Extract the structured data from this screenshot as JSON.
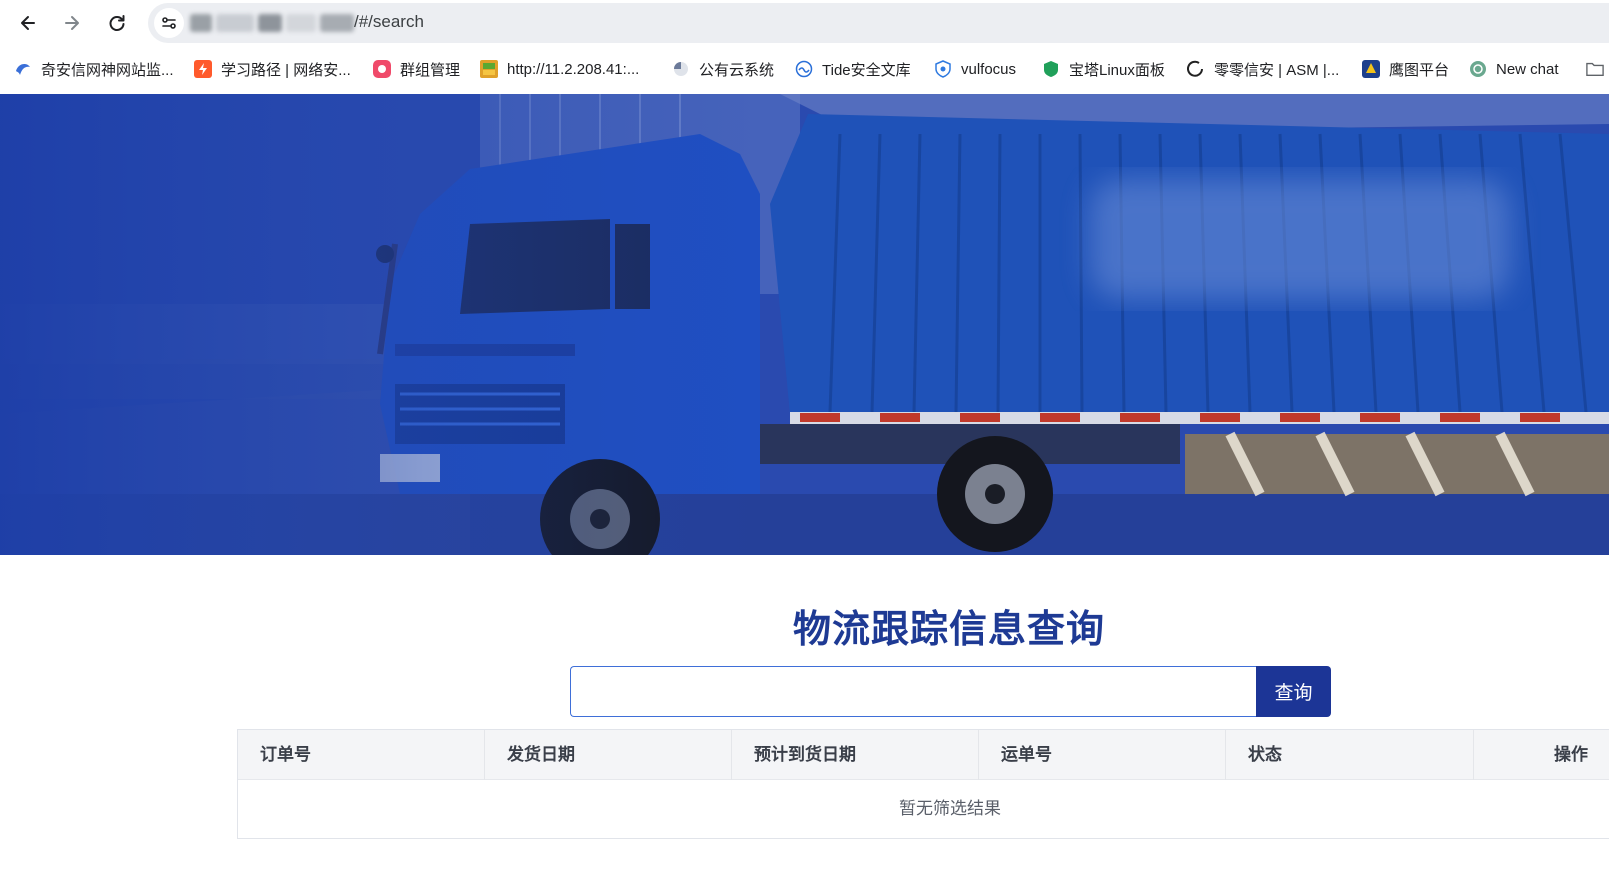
{
  "browser": {
    "url_visible": "/#/search",
    "nav": {
      "back_icon": "arrow-left-icon",
      "forward_icon": "arrow-right-icon",
      "reload_icon": "reload-icon"
    },
    "bookmarks": [
      {
        "label": "奇安信网神网站监...",
        "icon": "qianxin-icon",
        "color": "#3a6fd8"
      },
      {
        "label": "学习路径 | 网络安...",
        "icon": "bolt-icon",
        "color": "#ff5a2c"
      },
      {
        "label": "群组管理",
        "icon": "group-icon",
        "color": "#f04a6a"
      },
      {
        "label": "http://11.2.208.41:...",
        "icon": "cube-icon",
        "color": "#e0a12a"
      },
      {
        "label": "公有云系统",
        "icon": "cloud-icon",
        "color": "#6b7a99"
      },
      {
        "label": "Tide安全文库",
        "icon": "tide-icon",
        "color": "#2a6fd8"
      },
      {
        "label": "vulfocus",
        "icon": "shield-icon",
        "color": "#2f7ae0"
      },
      {
        "label": "宝塔Linux面板",
        "icon": "baota-icon",
        "color": "#20a05a"
      },
      {
        "label": "零零信安 | ASM |...",
        "icon": "ring-icon",
        "color": "#222222"
      },
      {
        "label": "鹰图平台",
        "icon": "eagle-icon",
        "color": "#f2c21a"
      },
      {
        "label": "New chat",
        "icon": "openai-icon",
        "color": "#6aa88f"
      },
      {
        "label": "",
        "icon": "folder-icon",
        "color": "#5f6368"
      }
    ]
  },
  "page": {
    "title": "物流跟踪信息查询",
    "search": {
      "input_value": "",
      "button_label": "查询"
    },
    "table": {
      "columns": [
        "订单号",
        "发货日期",
        "预计到货日期",
        "运单号",
        "状态",
        "操作"
      ],
      "empty_text": "暂无筛选结果"
    }
  },
  "colors": {
    "brand": "#1c3596",
    "title": "#1e3a94",
    "input_border": "#3f6fd8"
  }
}
